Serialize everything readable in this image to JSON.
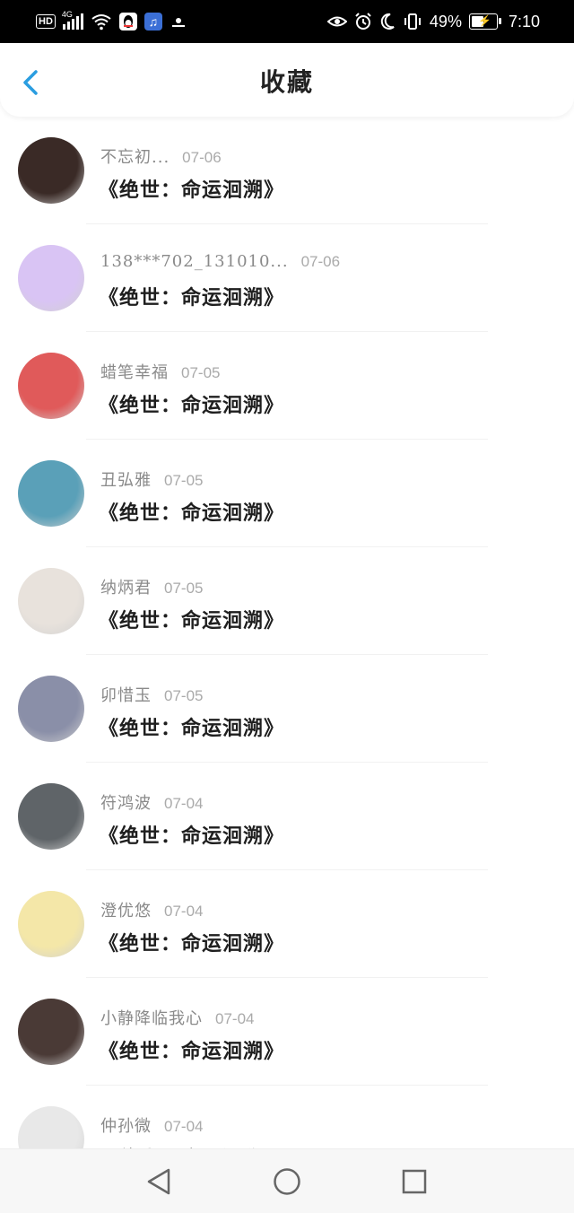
{
  "status_bar": {
    "network_type": "4G",
    "hd_label": "HD",
    "battery_percent": "49%",
    "battery_level": 0.49,
    "time": "7:10"
  },
  "header": {
    "title": "收藏"
  },
  "items": [
    {
      "name": "不忘初...",
      "date": "07-06",
      "book": "《绝世：命运洄溯》",
      "avatar_color": "#3a2a26"
    },
    {
      "name": "138***702_131010...",
      "date": "07-06",
      "book": "《绝世：命运洄溯》",
      "avatar_color": "#d9c4f4"
    },
    {
      "name": "蜡笔幸福",
      "date": "07-05",
      "book": "《绝世：命运洄溯》",
      "avatar_color": "#e05a5a"
    },
    {
      "name": "丑弘雅",
      "date": "07-05",
      "book": "《绝世：命运洄溯》",
      "avatar_color": "#5aa0b8"
    },
    {
      "name": "纳炳君",
      "date": "07-05",
      "book": "《绝世：命运洄溯》",
      "avatar_color": "#e8e2dc"
    },
    {
      "name": "卯惜玉",
      "date": "07-05",
      "book": "《绝世：命运洄溯》",
      "avatar_color": "#8a8fa8"
    },
    {
      "name": "符鸿波",
      "date": "07-04",
      "book": "《绝世：命运洄溯》",
      "avatar_color": "#5f6468"
    },
    {
      "name": "澄优悠",
      "date": "07-04",
      "book": "《绝世：命运洄溯》",
      "avatar_color": "#f4e7a8"
    },
    {
      "name": "小静降临我心",
      "date": "07-04",
      "book": "《绝世：命运洄溯》",
      "avatar_color": "#4a3a36"
    },
    {
      "name": "仲孙微",
      "date": "07-04",
      "book": "《绝世：命运洄溯》",
      "avatar_color": "#e8e8e8"
    }
  ]
}
